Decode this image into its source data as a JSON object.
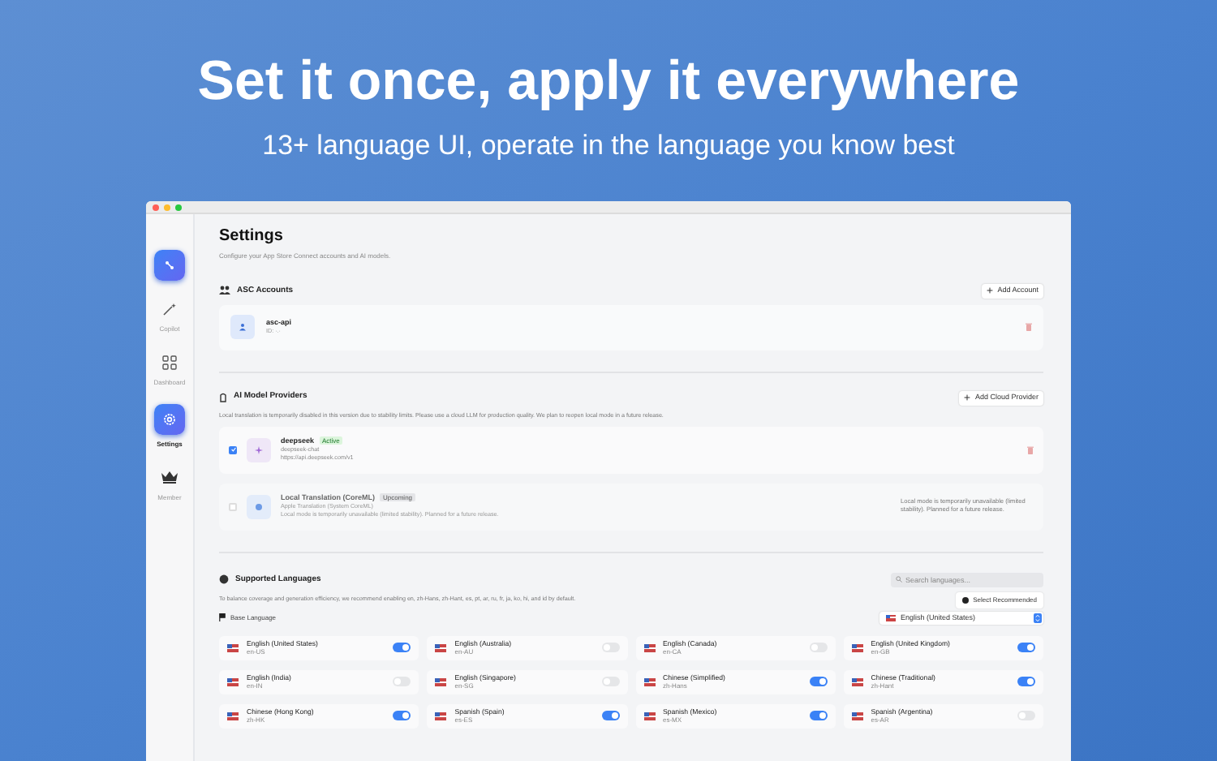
{
  "promo": {
    "headline": "Set it once, apply it everywhere",
    "subheadline": "13+ language UI, operate in the language you know best"
  },
  "sidebar": {
    "items": [
      {
        "kind": "logo"
      },
      {
        "kind": "wand",
        "label": "Copilot",
        "selected": false
      },
      {
        "kind": "grid",
        "label": "Dashboard",
        "selected": false
      },
      {
        "kind": "gear",
        "label": "Settings",
        "selected": true
      },
      {
        "kind": "crown",
        "label": "Member",
        "selected": false
      }
    ]
  },
  "settings": {
    "title": "Settings",
    "subtitle": "Configure your App Store Connect accounts and AI models."
  },
  "asc_accounts": {
    "heading": "ASC Accounts",
    "add_button": "Add Account",
    "accounts": [
      {
        "name": "asc-api",
        "id": "ID: ·.·"
      }
    ]
  },
  "ai_providers": {
    "heading": "AI Model Providers",
    "add_button": "Add Cloud Provider",
    "note": "Local translation is temporarily disabled in this version due to stability limits. Please use a cloud LLM for production quality. We plan to reopen local mode in a future release.",
    "providers": [
      {
        "name": "deepseek",
        "badge": "Active",
        "model": "deepseek-chat",
        "detail": "https://api.deepseek.com/v1",
        "checked": true,
        "disabled": false
      },
      {
        "name": "Local Translation (CoreML)",
        "badge": "Upcoming",
        "model": "Apple Translation (System CoreML)",
        "detail": "Local mode is temporarily unavailable (limited stability). Planned for a future release.",
        "side_note": "Local mode is temporarily unavailable (limited stability). Planned for a future release.",
        "checked": false,
        "disabled": true
      }
    ]
  },
  "languages": {
    "heading": "Supported Languages",
    "search": {
      "placeholder": "Search languages..."
    },
    "note": "To balance coverage and generation efficiency, we recommend enabling en, zh-Hans, zh-Hant, es, pt, ar, ru, fr, ja, ko, hi, and id by default.",
    "select_recommended": "Select Recommended",
    "base_language": {
      "label": "Base Language",
      "value": "English (United States)"
    },
    "items": [
      {
        "name": "English (United States)",
        "code": "en-US",
        "on": true
      },
      {
        "name": "English (Australia)",
        "code": "en-AU",
        "on": false
      },
      {
        "name": "English (Canada)",
        "code": "en-CA",
        "on": false
      },
      {
        "name": "English (United Kingdom)",
        "code": "en-GB",
        "on": true
      },
      {
        "name": "English (India)",
        "code": "en-IN",
        "on": false
      },
      {
        "name": "English (Singapore)",
        "code": "en-SG",
        "on": false
      },
      {
        "name": "Chinese (Simplified)",
        "code": "zh-Hans",
        "on": true
      },
      {
        "name": "Chinese (Traditional)",
        "code": "zh-Hant",
        "on": true
      },
      {
        "name": "Chinese (Hong Kong)",
        "code": "zh-HK",
        "on": true
      },
      {
        "name": "Spanish (Spain)",
        "code": "es-ES",
        "on": true
      },
      {
        "name": "Spanish (Mexico)",
        "code": "es-MX",
        "on": true
      },
      {
        "name": "Spanish (Argentina)",
        "code": "es-AR",
        "on": false
      }
    ]
  }
}
